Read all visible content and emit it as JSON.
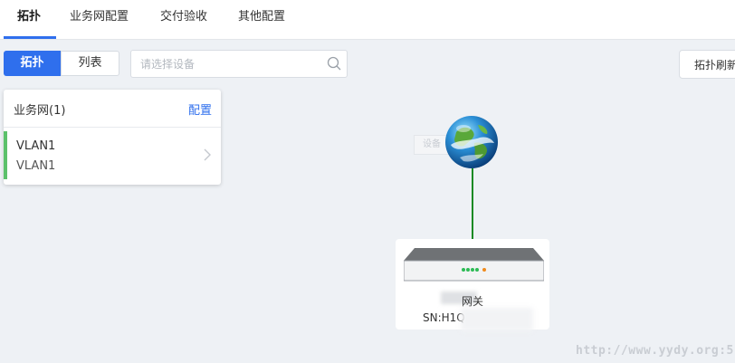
{
  "tabs": [
    {
      "label": "拓扑"
    },
    {
      "label": "业务网配置"
    },
    {
      "label": "交付验收"
    },
    {
      "label": "其他配置"
    }
  ],
  "view_toggle": {
    "topology": "拓扑",
    "list": "列表"
  },
  "search": {
    "placeholder": "请选择设备"
  },
  "refresh_label": "拓扑刷新",
  "panel": {
    "title": "业务网(1)",
    "config_label": "配置",
    "items": [
      {
        "name": "VLAN1",
        "sub": "VLAN1"
      }
    ]
  },
  "ghost_label": "设备",
  "device": {
    "name": "网关",
    "sn": "SN:H1Q"
  },
  "watermark": "http://www.yydy.org:5",
  "colors": {
    "accent": "#2f6fed",
    "vlan_bar": "#5cc16b",
    "link": "#1b8a24"
  }
}
